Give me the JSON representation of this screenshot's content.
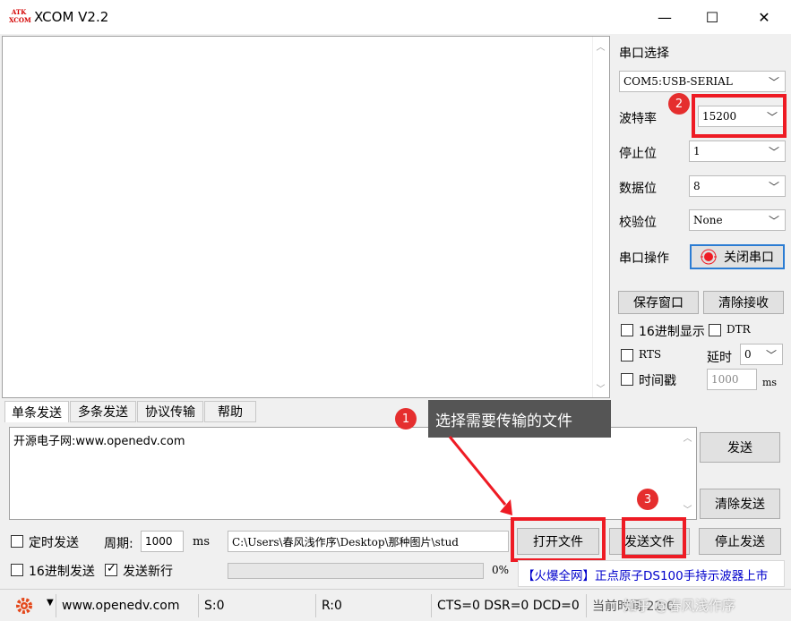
{
  "window": {
    "title": "XCOM V2.2",
    "logo_text_top": "ATK",
    "logo_text_bottom": "XCOM",
    "minimize": "—",
    "maximize": "☐",
    "close": "✕"
  },
  "serial": {
    "port_label": "串口选择",
    "port_value": "COM5:USB-SERIAL",
    "baud_label": "波特率",
    "baud_value": "15200",
    "stop_label": "停止位",
    "stop_value": "1",
    "data_label": "数据位",
    "data_value": "8",
    "parity_label": "校验位",
    "parity_value": "None",
    "op_label": "串口操作",
    "op_button": "关闭串口",
    "save_button": "保存窗口",
    "clear_rx_button": "清除接收",
    "hex_display": "16进制显示",
    "dtr": "DTR",
    "rts": "RTS",
    "delay_label": "延时",
    "delay_value": "0",
    "timestamp": "时间戳",
    "timestamp_value": "1000",
    "ms_unit": "ms"
  },
  "tabs": [
    "单条发送",
    "多条发送",
    "协议传输",
    "帮助"
  ],
  "send": {
    "text": "开源电子网:www.openedv.com",
    "send_button": "发送",
    "clear_send_button": "清除发送",
    "timed_send": "定时发送",
    "period_label": "周期:",
    "period_value": "1000",
    "period_unit": "ms",
    "hex_send": "16进制发送",
    "newline": "发送新行",
    "file_path": "C:\\Users\\春风浅作序\\Desktop\\那种图片\\stud",
    "open_file_button": "打开文件",
    "send_file_button": "发送文件",
    "stop_send_button": "停止发送",
    "progress_text": "0%",
    "ad_text": "【火爆全网】正点原子DS100手持示波器上市"
  },
  "annotations": {
    "badge1": "1",
    "badge2": "2",
    "badge3": "3",
    "tooltip": "选择需要传输的文件"
  },
  "status": {
    "site": "www.openedv.com",
    "sent": "S:0",
    "received": "R:0",
    "signals": "CTS=0 DSR=0 DCD=0",
    "time_label": "当前时间 22:0",
    "watermark": "知乎 @春风浅作序"
  },
  "colors": {
    "accent_red": "#ee1b24",
    "badge_red": "#e52e2e",
    "ad_blue": "#0000cc"
  }
}
